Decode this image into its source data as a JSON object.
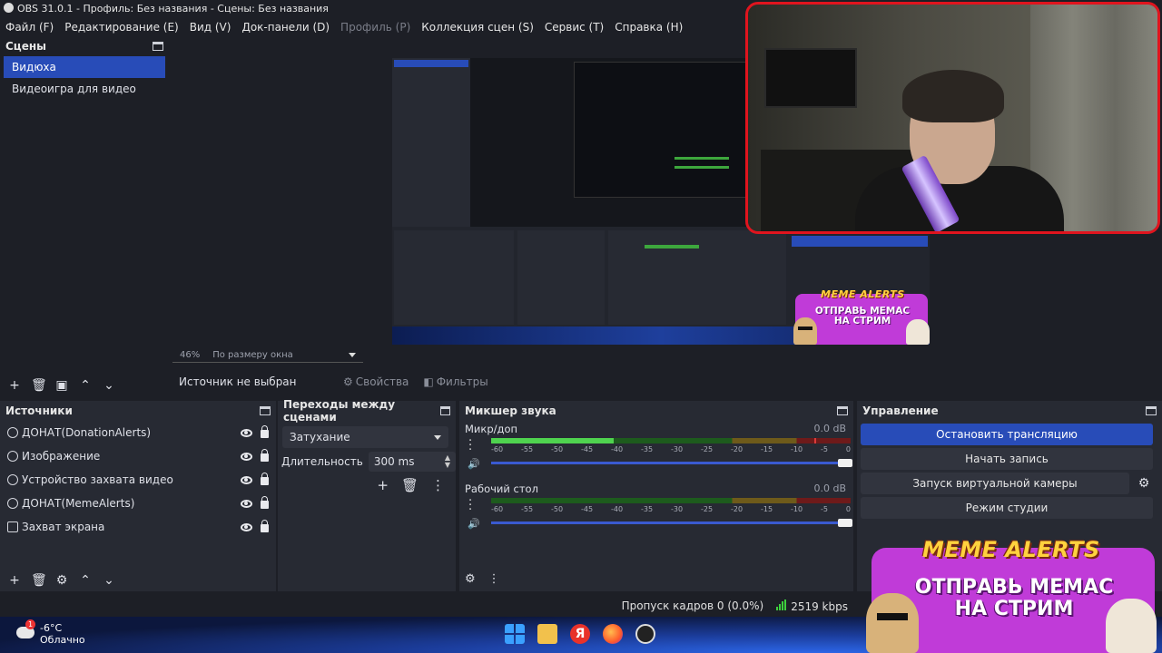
{
  "window": {
    "title": "OBS 31.0.1 - Профиль: Без названия - Сцены: Без названия"
  },
  "menu": [
    {
      "label": "Файл (F)",
      "enabled": true
    },
    {
      "label": "Редактирование (E)",
      "enabled": true
    },
    {
      "label": "Вид (V)",
      "enabled": true
    },
    {
      "label": "Док-панели (D)",
      "enabled": true
    },
    {
      "label": "Профиль (P)",
      "enabled": false
    },
    {
      "label": "Коллекция сцен (S)",
      "enabled": true
    },
    {
      "label": "Сервис (T)",
      "enabled": true
    },
    {
      "label": "Справка (H)",
      "enabled": true
    }
  ],
  "scenes": {
    "title": "Сцены",
    "items": [
      {
        "label": "Видюха",
        "selected": true
      },
      {
        "label": "Видеоигра для видео",
        "selected": false
      }
    ]
  },
  "preview": {
    "zoom": "46%",
    "zoom_mode": "По размеру окна"
  },
  "context": {
    "no_source": "Источник не выбран",
    "properties": "Свойства",
    "filters": "Фильтры"
  },
  "sources": {
    "title": "Источники",
    "items": [
      {
        "label": "ДОНАТ(DonationAlerts)",
        "icon": "globe-icon"
      },
      {
        "label": "Изображение",
        "icon": "image-icon"
      },
      {
        "label": "Устройство захвата видео",
        "icon": "camera-icon"
      },
      {
        "label": "ДОНАТ(MemeAlerts)",
        "icon": "globe-icon"
      },
      {
        "label": "Захват экрана",
        "icon": "monitor-icon"
      }
    ]
  },
  "transitions": {
    "title": "Переходы между сценами",
    "selected": "Затухание",
    "duration_label": "Длительность",
    "duration_value": "300 ms"
  },
  "mixer": {
    "title": "Микшер звука",
    "ticks": [
      "-60",
      "-55",
      "-50",
      "-45",
      "-40",
      "-35",
      "-30",
      "-25",
      "-20",
      "-15",
      "-10",
      "-5",
      "0"
    ],
    "channels": [
      {
        "name": "Микр/доп",
        "db": "0.0 dB",
        "level": 0.34,
        "peak": 0.9
      },
      {
        "name": "Рабочий стол",
        "db": "0.0 dB",
        "level": 0.0,
        "peak": 0.0
      }
    ]
  },
  "controls": {
    "title": "Управление",
    "stop_stream": "Остановить трансляцию",
    "start_record": "Начать запись",
    "virtual_cam": "Запуск виртуальной камеры",
    "studio_mode": "Режим студии"
  },
  "status": {
    "dropped_frames": "Пропуск кадров 0 (0.0%)",
    "bitrate": "2519 kbps"
  },
  "taskbar": {
    "temperature": "-6°C",
    "weather": "Облачно",
    "weather_badge": "1",
    "yandex_letter": "Я"
  },
  "overlay": {
    "meme_title": "MEME ALERTS",
    "meme_text": "ОТПРАВЬ МЕМАС НА СТРИМ"
  },
  "colors": {
    "accent": "#284cb8",
    "background": "#1d1f26",
    "dock": "#272a33",
    "webcam_border": "#e0141e",
    "meter_green": "#4fd34f"
  }
}
